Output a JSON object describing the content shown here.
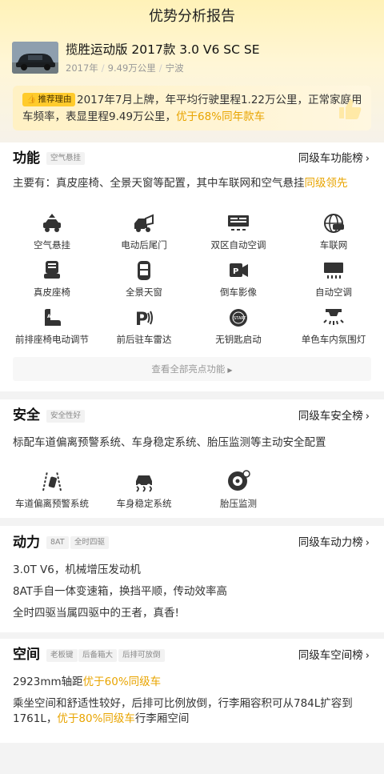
{
  "header": {
    "title": "优势分析报告"
  },
  "car": {
    "name": "揽胜运动版 2017款 3.0 V6 SC SE",
    "year": "2017年",
    "mileage": "9.49万公里",
    "city": "宁波",
    "sep": "/"
  },
  "reason": {
    "tag": "推荐理由",
    "text_before": "2017年7月上牌，年平均行驶里程1.22万公里，正常家庭用车频率，表显里程9.49万公里，",
    "highlight": "优于68%同年款车"
  },
  "function": {
    "title": "功能",
    "tag": "空气悬挂",
    "rank": "同级车功能榜",
    "summary_before": "主要有：真皮座椅、全景天窗等配置，其中车联网和空气悬挂",
    "summary_highlight": "同级领先",
    "items": [
      {
        "label": "空气悬挂",
        "icon": "air-suspension-icon"
      },
      {
        "label": "电动后尾门",
        "icon": "power-tailgate-icon"
      },
      {
        "label": "双区自动空调",
        "icon": "dual-zone-ac-icon"
      },
      {
        "label": "车联网",
        "icon": "connected-car-icon"
      },
      {
        "label": "真皮座椅",
        "icon": "leather-seat-icon"
      },
      {
        "label": "全景天窗",
        "icon": "panoramic-sunroof-icon"
      },
      {
        "label": "倒车影像",
        "icon": "reverse-camera-icon"
      },
      {
        "label": "自动空调",
        "icon": "auto-ac-icon"
      },
      {
        "label": "前排座椅电动调节",
        "icon": "power-seat-icon"
      },
      {
        "label": "前后驻车雷达",
        "icon": "parking-radar-icon"
      },
      {
        "label": "无钥匙启动",
        "icon": "keyless-start-icon"
      },
      {
        "label": "单色车内氛围灯",
        "icon": "ambient-light-icon"
      }
    ],
    "more": "查看全部亮点功能"
  },
  "safety": {
    "title": "安全",
    "tag": "安全性好",
    "rank": "同级车安全榜",
    "summary": "标配车道偏离预警系统、车身稳定系统、胎压监测等主动安全配置",
    "items": [
      {
        "label": "车道偏离预警系统",
        "icon": "lane-departure-icon"
      },
      {
        "label": "车身稳定系统",
        "icon": "stability-control-icon"
      },
      {
        "label": "胎压监测",
        "icon": "tire-pressure-icon"
      }
    ]
  },
  "power": {
    "title": "动力",
    "tags": [
      "8AT",
      "全时四驱"
    ],
    "rank": "同级车动力榜",
    "lines": [
      "3.0T V6，机械增压发动机",
      "8AT手自一体变速箱，换挡平顺，传动效率高",
      "全时四驱当属四驱中的王者，真香!"
    ]
  },
  "space": {
    "title": "空间",
    "tags": [
      "老板键",
      "后备箱大",
      "后排可放倒"
    ],
    "rank": "同级车空间榜",
    "line1_before": "2923mm轴距",
    "line1_highlight": "优于60%同级车",
    "line2": "乘坐空间和舒适性较好，后排可比例放倒，行李厢容积可从784L扩容到",
    "line3_before": "1761L，",
    "line3_highlight": "优于80%同级车",
    "line3_after": "行李厢空间"
  },
  "colors": {
    "accent": "#e8a400",
    "tag_yellow": "#ffcb2b",
    "header_bg": "#fff2b8"
  }
}
